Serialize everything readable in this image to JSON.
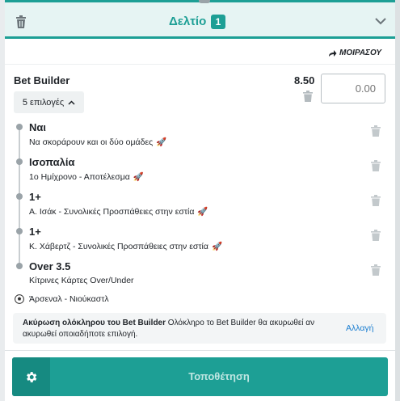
{
  "colors": {
    "accent": "#1d9f95",
    "link": "#1d7fd1"
  },
  "header": {
    "title": "Δελτίο",
    "count": "1",
    "icons": {
      "clear": "trash-icon",
      "collapse": "chevron-down-icon"
    }
  },
  "share": {
    "label": "ΜΟΙΡΑΣΟΥ",
    "icon": "share-arrow-icon"
  },
  "bet_builder": {
    "title": "Bet Builder",
    "odds": "8.50",
    "stake_placeholder": "0.00",
    "selections_label": "5 επιλογές"
  },
  "legs": [
    {
      "pick": "Ναι",
      "market": "Να σκοράρουν και οι δύο ομάδες"
    },
    {
      "pick": "Ισοπαλία",
      "market": "1ο Ημίχρονο - Αποτέλεσμα"
    },
    {
      "pick": "1+",
      "market": "Α. Ισάκ - Συνολικές Προσπάθειες στην εστία"
    },
    {
      "pick": "1+",
      "market": "Κ. Χάβερτζ - Συνολικές Προσπάθειες στην εστία"
    },
    {
      "pick": "Over 3.5",
      "market": "Κίτρινες Κάρτες Over/Under"
    }
  ],
  "event": {
    "name": "Άρσεναλ - Νιούκαστλ",
    "icon": "football-icon"
  },
  "notice": {
    "bold": "Ακύρωση ολόκληρου του Bet Builder",
    "text": " Ολόκληρο το Bet Builder θα ακυρωθεί αν ακυρωθεί οποιαδήποτε επιλογή.",
    "action": "Αλλαγή"
  },
  "place_bet": {
    "label": "Τοποθέτηση",
    "icon": "gear-icon"
  }
}
